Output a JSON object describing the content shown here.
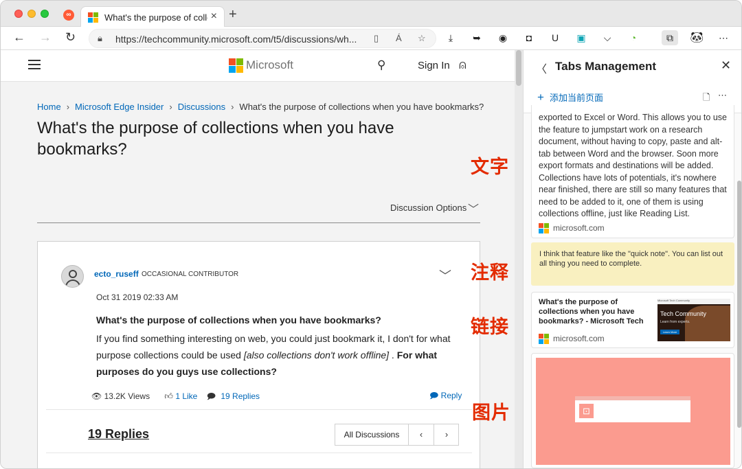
{
  "browser": {
    "tab_title": "What's the purpose of collec",
    "url": "https://techcommunity.microsoft.com/t5/discussions/wh...",
    "reader_icon": "Á",
    "accent": "#0067b8"
  },
  "site": {
    "brand": "Microsoft",
    "sign_in": "Sign In"
  },
  "breadcrumb": {
    "home": "Home",
    "insider": "Microsoft Edge Insider",
    "discussions": "Discussions",
    "current": "What's the purpose of collections when you have bookmarks?"
  },
  "page": {
    "title": "What's the purpose of collections when you have bookmarks?",
    "discussion_options": "Discussion Options"
  },
  "post": {
    "author": "ecto_ruseff",
    "rank": "OCCASIONAL CONTRIBUTOR",
    "date": "Oct 31 2019 02:33 AM",
    "title": "What's the purpose of collections when you have bookmarks?",
    "body_1": "If you find something interesting on web, you could just bookmark it, I don't for what purpose collections could be used ",
    "body_em": "[also collections don't work offline]",
    "body_2": " . ",
    "body_strong": "For what purposes do you guys use collections?",
    "views": "13.2K Views",
    "likes": "1 Like",
    "replies": "19 Replies",
    "reply": "Reply"
  },
  "replies_section": {
    "heading": "19 Replies",
    "all_discussions": "All Discussions",
    "prev": "‹",
    "next": "›"
  },
  "overlay_labels": {
    "text": "文字",
    "note": "注释",
    "link": "链接",
    "image": "图片",
    "color": "#e32b00"
  },
  "sidebar": {
    "title": "Tabs Management",
    "add_current_page": "添加当前页面",
    "text_card": "exported to Excel or Word. This allows you to use the feature to jumpstart work on a research document, without having to copy, paste and alt-tab between Word and the browser. Soon more export formats and destinations will be added. Collections have lots of potentials, it's nowhere near finished, there are still so many features that need to be added to it, one of them is using collections offline, just like Reading List.",
    "text_card_source": "microsoft.com",
    "note_text": "I think that feature like the \"quick note\". You can list out all thing you need to complete.",
    "note_color": "#f9f0c0",
    "link_title": "What's the purpose of collections when you have bookmarks? - Microsoft Tech",
    "link_source": "microsoft.com",
    "thumb_title": "Tech Community",
    "thumb_subtitle": "Learn from experts.",
    "thumb_button": "Learn More",
    "thumb_topbar": "Microsoft Tech Community",
    "image_color": "#fb9b8f"
  }
}
